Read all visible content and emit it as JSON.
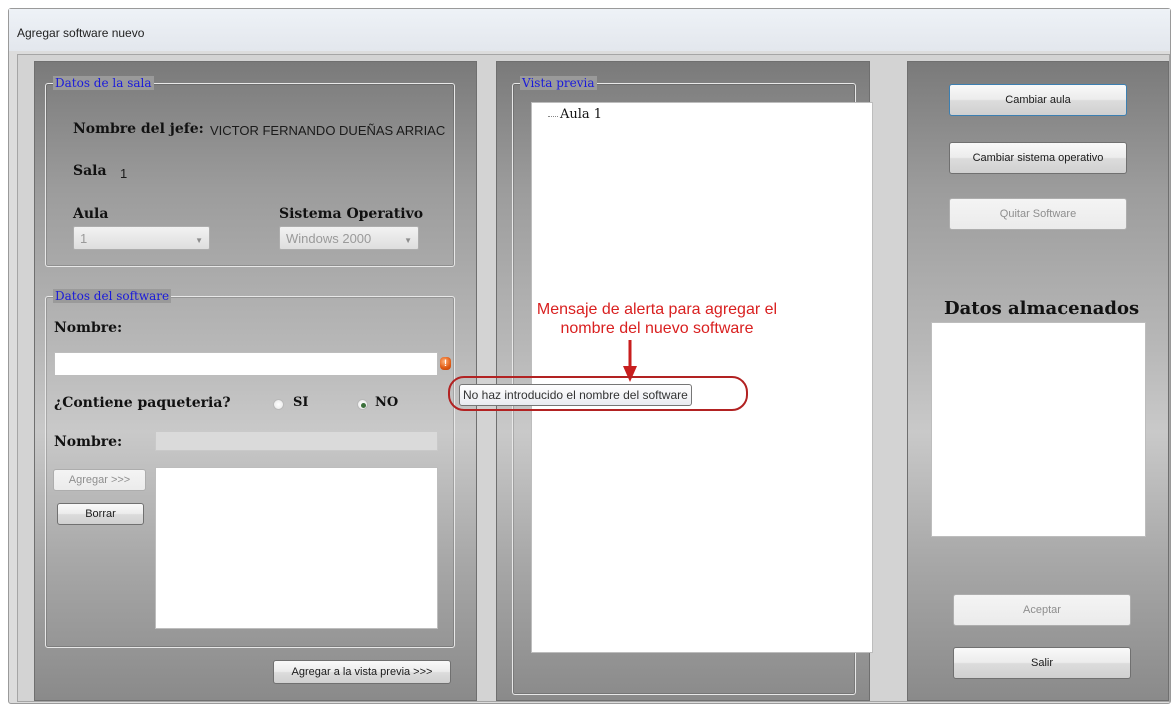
{
  "window": {
    "title": "Agregar software nuevo"
  },
  "sala": {
    "legend": "Datos de la sala",
    "jefe_label": "Nombre del jefe:",
    "jefe_value": "VICTOR FERNANDO DUEÑAS ARRIAC",
    "sala_label": "Sala",
    "sala_value": "1",
    "aula_label": "Aula",
    "aula_value": "1",
    "so_label": "Sistema Operativo",
    "so_value": "Windows 2000"
  },
  "software": {
    "legend": "Datos del software",
    "nombre_label": "Nombre:",
    "nombre_value": "",
    "paqueteria_label": "¿Contiene paqueteria?",
    "si_label": "SI",
    "no_label": "NO",
    "selected": "NO",
    "paquete_label": "Nombre:",
    "agregar_button": "Agregar >>>",
    "borrar_button": "Borrar",
    "vista_button": "Agregar a la vista previa >>>"
  },
  "vista": {
    "legend": "Vista previa",
    "tree": [
      "Aula 1"
    ]
  },
  "actions": {
    "cambiar_aula": "Cambiar aula",
    "cambiar_so": "Cambiar sistema operativo",
    "quitar_software": "Quitar Software",
    "datos_title": "Datos almacenados",
    "aceptar": "Aceptar",
    "salir": "Salir"
  },
  "annotation": {
    "line1": "Mensaje de alerta para agregar el",
    "line2": "nombre del nuevo software",
    "tooltip": "No haz introducido el nombre del software"
  },
  "colors": {
    "legend_text": "#1a1adb",
    "annotation": "#d92020",
    "error_icon": "#e05a12"
  }
}
